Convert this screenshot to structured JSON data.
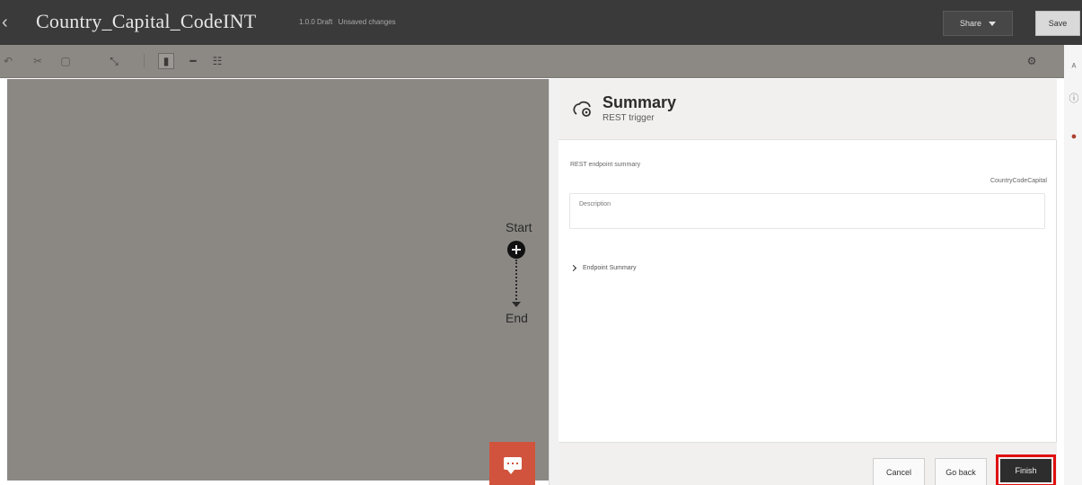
{
  "header": {
    "title": "Country_Capital_CodeINT",
    "version": "1.0.0 Draft",
    "status": "Unsaved changes",
    "share_label": "Share",
    "save_label": "Save"
  },
  "toolbar": {
    "icons": [
      "undo-icon",
      "cut-icon",
      "paste-icon",
      "collapse-icon",
      "vertical-layout-icon",
      "horizontal-layout-icon",
      "freeform-layout-icon",
      "settings-icon"
    ]
  },
  "canvas": {
    "start_label": "Start",
    "end_label": "End"
  },
  "panel": {
    "title": "Summary",
    "subtitle": "REST trigger",
    "section_label": "REST endpoint summary",
    "endpoint_name": "CountryCodeCapital",
    "description_label": "Description",
    "endpoint_summary_label": "Endpoint Summary"
  },
  "footer": {
    "cancel_label": "Cancel",
    "goback_label": "Go back",
    "finish_label": "Finish"
  },
  "colors": {
    "header_bg": "#3a3a3a",
    "canvas_bg": "#8b8884",
    "chat_button": "#d1533d",
    "finish_highlight": "#e01010"
  }
}
